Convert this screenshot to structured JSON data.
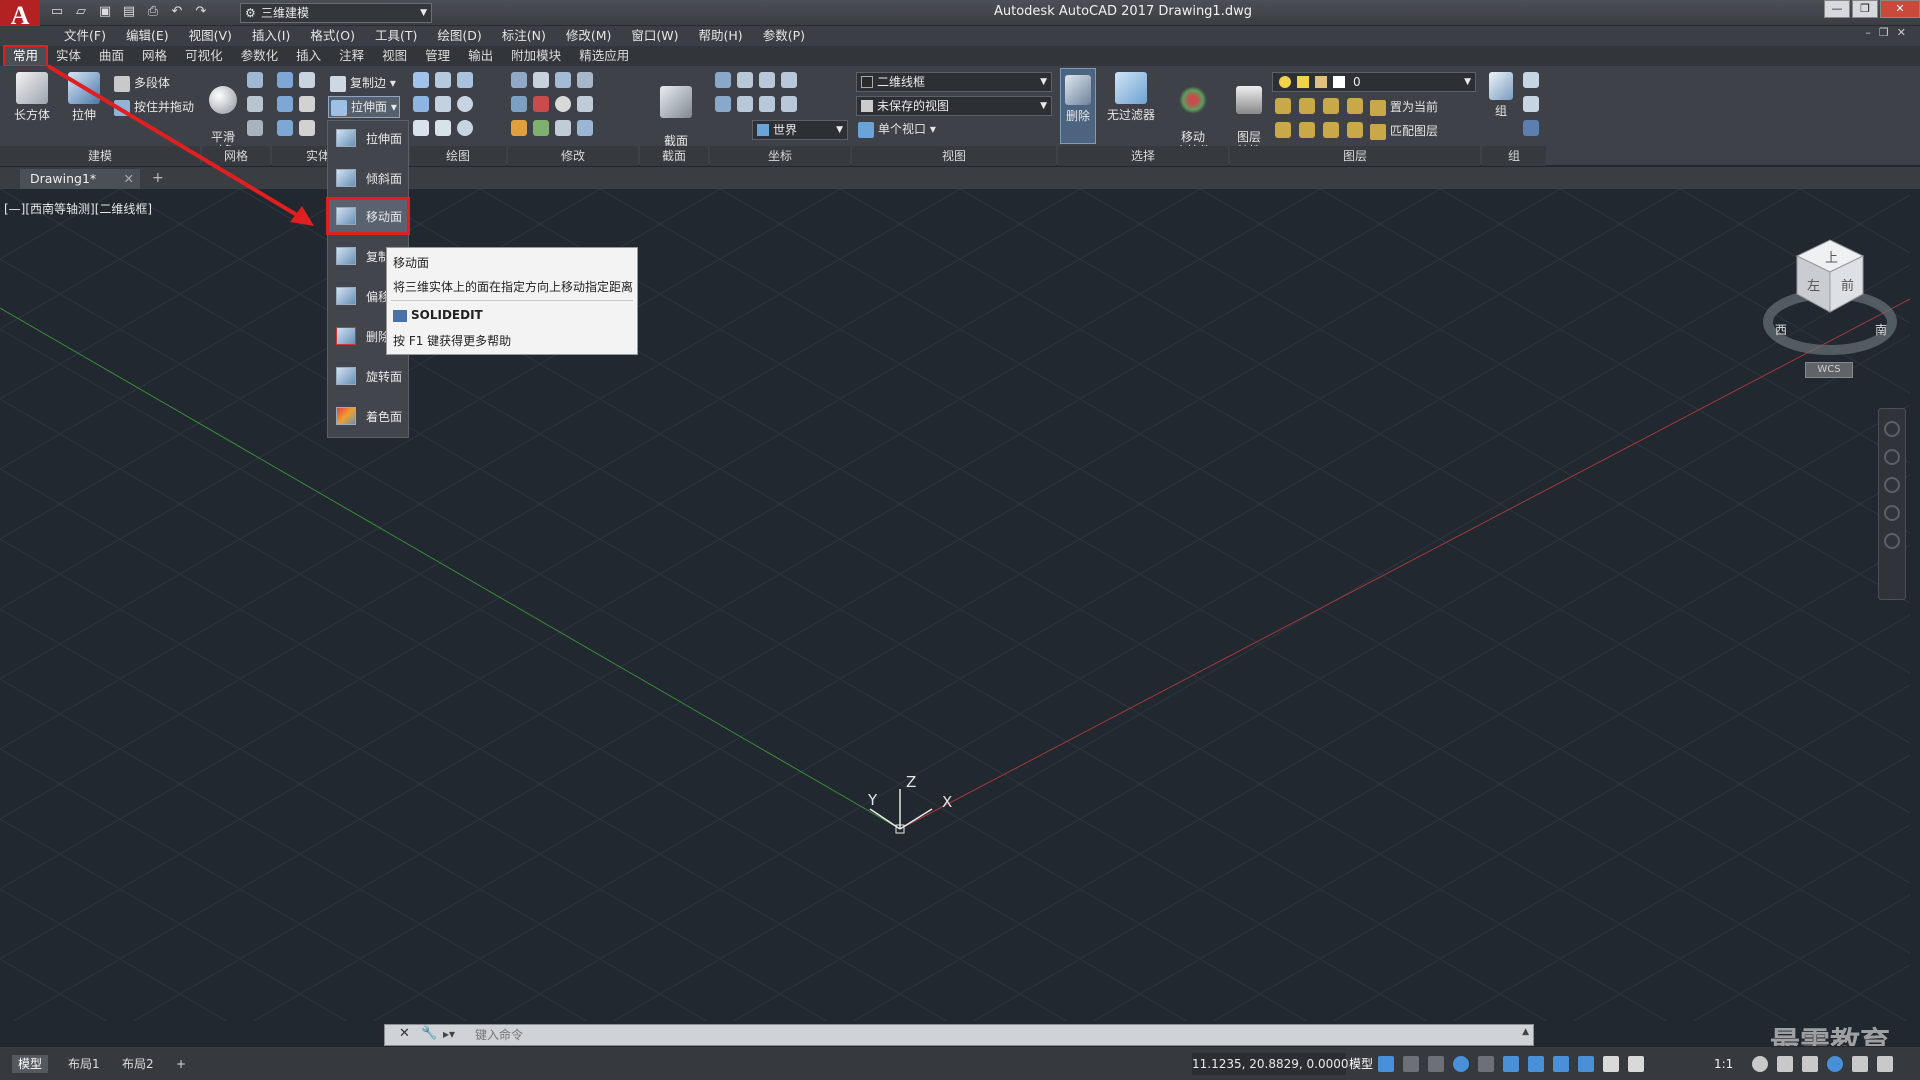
{
  "titlebar": {
    "app_logo": "A",
    "workspace": "三维建模",
    "title": "Autodesk AutoCAD 2017    Drawing1.dwg",
    "minimize": "—",
    "restore": "❐",
    "close": "✕"
  },
  "menubar": {
    "items": [
      "文件(F)",
      "编辑(E)",
      "视图(V)",
      "插入(I)",
      "格式(O)",
      "工具(T)",
      "绘图(D)",
      "标注(N)",
      "修改(M)",
      "窗口(W)",
      "帮助(H)",
      "参数(P)"
    ]
  },
  "ribbon_tabs": {
    "items": [
      "常用",
      "实体",
      "曲面",
      "网格",
      "可视化",
      "参数化",
      "插入",
      "注释",
      "视图",
      "管理",
      "输出",
      "附加模块",
      "精选应用"
    ],
    "active": "常用"
  },
  "ribbon": {
    "box": "长方体",
    "extrude": "拉伸",
    "polysolid": "多段体",
    "presspull": "按住并拖动",
    "smooth": "平滑\n对象",
    "copy_edge": "复制边",
    "extrude_face": "拉伸面",
    "section_plane": "截面\n平面",
    "visual_style": "二维线框",
    "saved_view": "未保存的视图",
    "ucs_world": "世界",
    "single_viewport": "单个视口",
    "delete": "删除",
    "no_filter": "无过滤器",
    "gizmo": "移动\n小控件",
    "layer_props": "图层\n特性",
    "layer_value": "0",
    "set_current": "置为当前",
    "match_layer": "匹配图层",
    "group": "组",
    "panels": [
      "建模",
      "网格",
      "实体",
      "绘图",
      "修改",
      "截面",
      "坐标",
      "视图",
      "选择",
      "图层",
      "组"
    ]
  },
  "file_tabs": {
    "active": "Drawing1*"
  },
  "viewport": {
    "label": "[—][西南等轴测][二维线框]",
    "axis_x": "X",
    "axis_y": "Y",
    "axis_z": "Z",
    "viewcube": {
      "top": "上",
      "left": "左",
      "front": "前",
      "west": "西",
      "south": "南"
    },
    "wcs": "WCS"
  },
  "face_menu": {
    "items": [
      "拉伸面",
      "倾斜面",
      "移动面",
      "复制面",
      "偏移面",
      "删除面",
      "旋转面",
      "着色面"
    ],
    "highlighted": "移动面"
  },
  "tooltip": {
    "title": "移动面",
    "description": "将三维实体上的面在指定方向上移动指定距离",
    "command": "SOLIDEDIT",
    "help": "按 F1 键获得更多帮助"
  },
  "command_line": {
    "placeholder": "键入命令"
  },
  "statusbar": {
    "tabs": [
      "模型",
      "布局1",
      "布局2"
    ],
    "coords": "11.1235, 20.8829, 0.0000",
    "model": "模型",
    "scale": "1:1"
  },
  "watermark": "最需教育",
  "colors": {
    "viewport_bg": "#212830",
    "highlight_red": "#e02020",
    "x_axis": "#b03a3a",
    "y_axis": "#3a8a3a"
  }
}
